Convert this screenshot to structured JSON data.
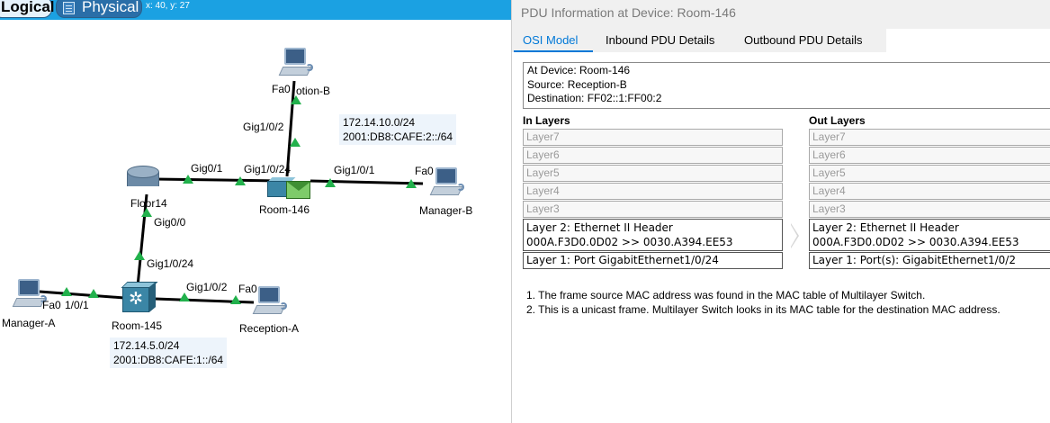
{
  "workspace": {
    "tabs": {
      "logical": "Logical",
      "physical": "Physical"
    },
    "coordinates": "x: 40, y: 27",
    "devices": {
      "router": "Floor14",
      "room146": "Room-146",
      "room145": "Room-145",
      "reception_b": "otion-B",
      "manager_b": "Manager-B",
      "manager_a": "Manager-A",
      "reception_a": "Reception-A"
    },
    "ports": {
      "fa0_top": "Fa0",
      "gig1_0_2_top": "Gig1/0/2",
      "gig0_1": "Gig0/1",
      "gig1_0_24_top": "Gig1/0/24",
      "gig1_0_1_right": "Gig1/0/1",
      "fa0_right": "Fa0",
      "gig0_0": "Gig0/0",
      "gig1_0_24_bottom": "Gig1/0/24",
      "gig1_0_2_bottom": "Gig1/0/2",
      "fa0_bottom": "Fa0",
      "fa0_left": "Fa0",
      "gig1_0_1_left": "1/0/1"
    },
    "networks": {
      "top": {
        "ipv4": "172.14.10.0/24",
        "ipv6": "2001:DB8:CAFE:2::/64"
      },
      "bottom": {
        "ipv4": "172.14.5.0/24",
        "ipv6": "2001:DB8:CAFE:1::/64"
      }
    },
    "colors": {
      "link": "#000000",
      "link_up": "#22b14c",
      "topbar": "#1ba1e2"
    }
  },
  "pdu": {
    "title": "PDU Information at Device: Room-146",
    "tabs": {
      "osi": "OSI Model",
      "inbound": "Inbound PDU Details",
      "outbound": "Outbound PDU Details"
    },
    "at_device": "At Device: Room-146",
    "source": "Source: Reception-B",
    "destination": "Destination: FF02::1:FF00:2",
    "in_header": "In Layers",
    "out_header": "Out Layers",
    "in_layers": {
      "l7": "Layer7",
      "l6": "Layer6",
      "l5": "Layer5",
      "l4": "Layer4",
      "l3": "Layer3",
      "l2_title": "Layer 2: Ethernet II Header",
      "l2_detail": "000A.F3D0.0D02 >> 0030.A394.EE53",
      "l1": "Layer 1: Port GigabitEthernet1/0/24"
    },
    "out_layers": {
      "l7": "Layer7",
      "l6": "Layer6",
      "l5": "Layer5",
      "l4": "Layer4",
      "l3": "Layer3",
      "l2_title": "Layer 2: Ethernet II Header",
      "l2_detail": "000A.F3D0.0D02 >> 0030.A394.EE53",
      "l1": "Layer 1: Port(s): GigabitEthernet1/0/2"
    },
    "notes": [
      "1. The frame source MAC address was found in the MAC table of Multilayer Switch.",
      "2. This is a unicast frame. Multilayer Switch looks in its MAC table for the destination MAC address."
    ]
  }
}
